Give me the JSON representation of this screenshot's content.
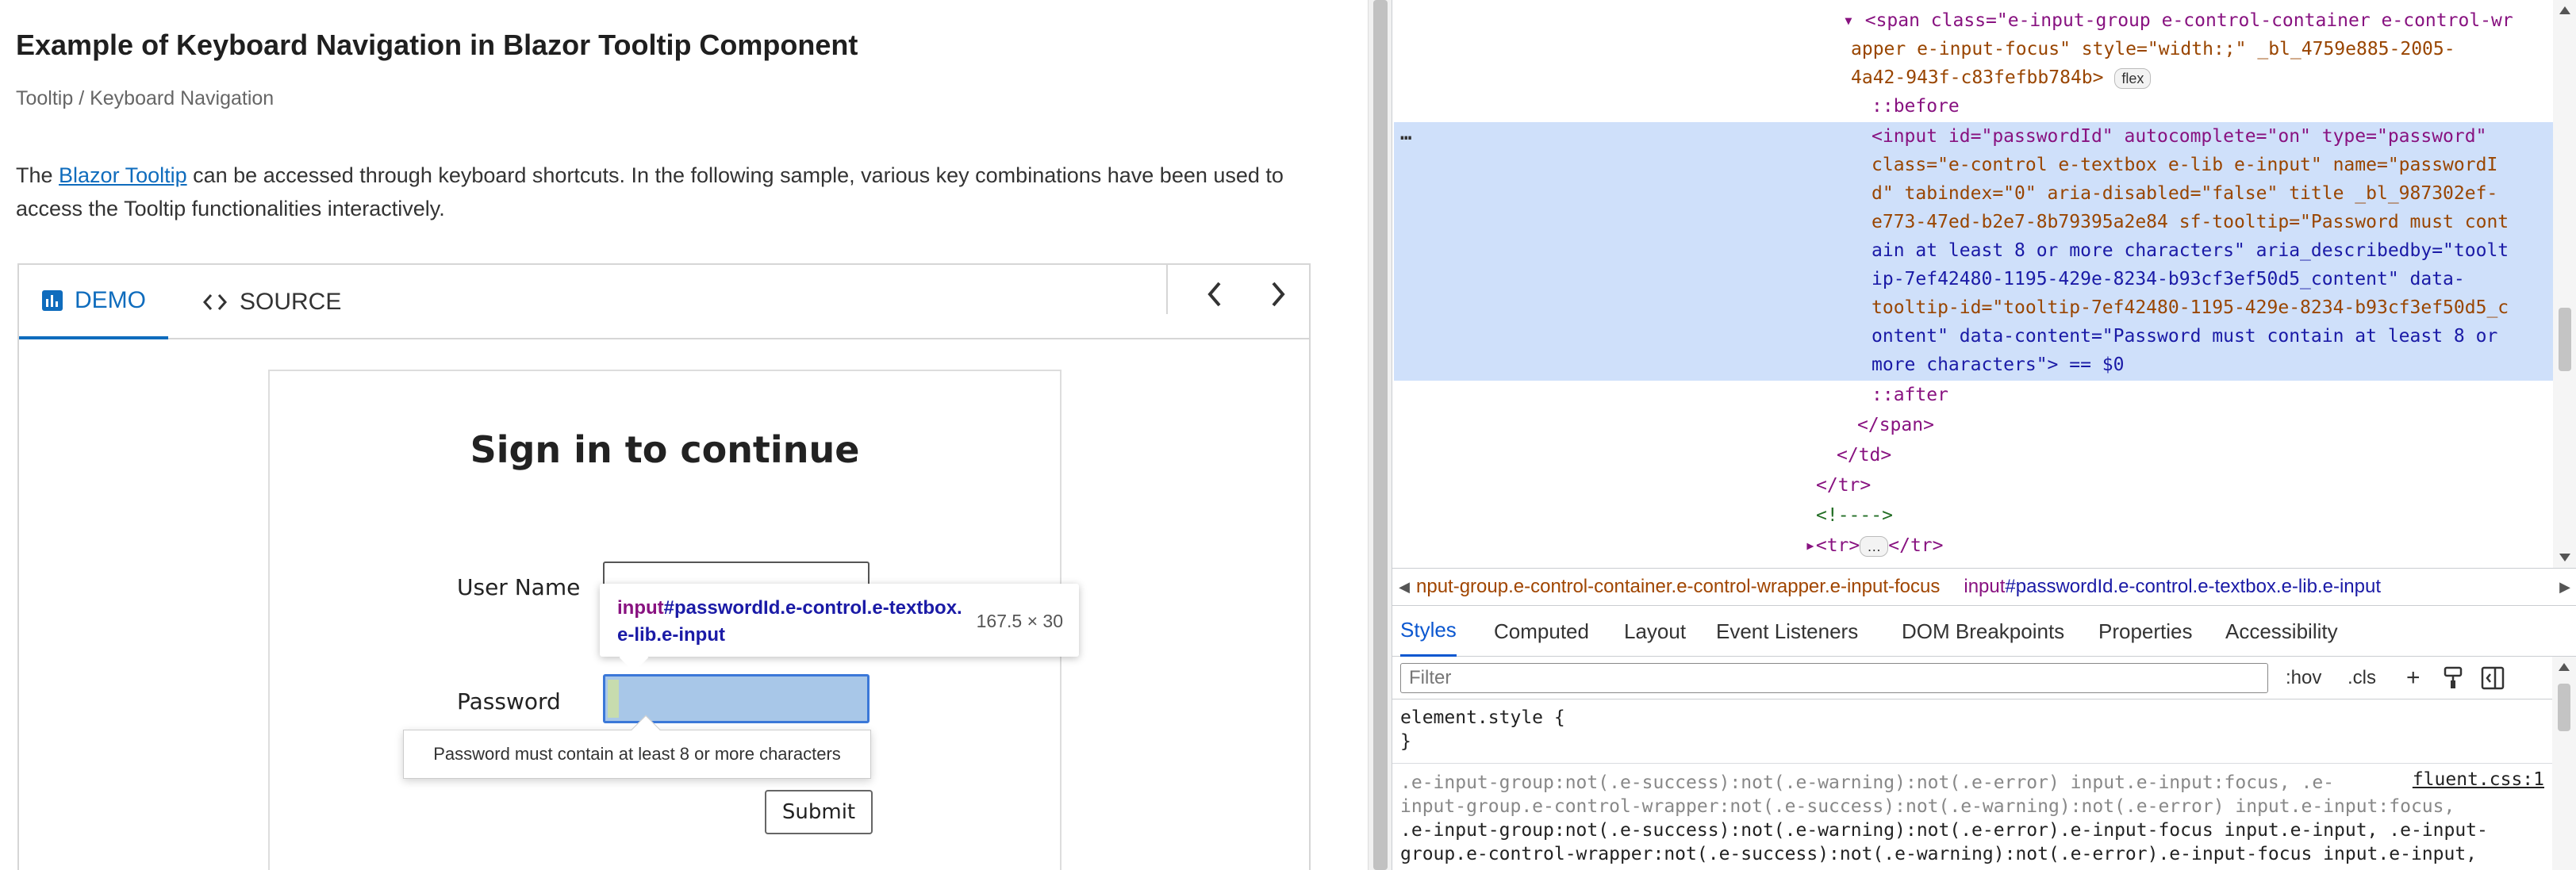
{
  "page": {
    "title": "Example of Keyboard Navigation in Blazor Tooltip Component",
    "breadcrumb": "Tooltip / Keyboard Navigation",
    "desc_before": "The ",
    "desc_link": "Blazor Tooltip",
    "desc_after": " can be accessed through keyboard shortcuts. In the following sample, various key combinations have been used to access the Tooltip functionalities interactively."
  },
  "demo": {
    "tabs": {
      "demo": "DEMO",
      "source": "SOURCE"
    },
    "icons": {
      "demo": "chart-icon",
      "source": "code-icon",
      "prev": "chevron-left-icon",
      "next": "chevron-right-icon"
    },
    "form": {
      "heading": "Sign in to continue",
      "username_label": "User Name",
      "password_label": "Password",
      "submit": "Submit"
    },
    "tooltip_text": "Password must contain at least 8 or more characters"
  },
  "inspect_tip": {
    "tag": "input",
    "selector": "#passwordId.e-control.e-textbox.e-lib.e-input",
    "size": "167.5 × 30"
  },
  "devtools": {
    "dom_lines": {
      "l1": "<span class=\"e-input-group e-control-container e-control-wr",
      "l2": "apper e-input-focus\" style=\"width:;\" _bl_4759e885-2005-",
      "l3": "4a42-943f-c83fefbb784b>",
      "l3_badge": "flex",
      "l4": "::before",
      "l5": "<input id=\"passwordId\" autocomplete=\"on\" type=\"password\"",
      "l6": "class=\"e-control e-textbox e-lib e-input\" name=\"passwordI",
      "l7": "d\" tabindex=\"0\" aria-disabled=\"false\" title _bl_987302ef-",
      "l8": "e773-47ed-b2e7-8b79395a2e84 sf-tooltip=\"Password must cont",
      "l9": "ain at least 8 or more characters\" aria_describedby=\"toolt",
      "l10": "ip-7ef42480-1195-429e-8234-b93cf3ef50d5_content\" data-",
      "l11": "tooltip-id=\"tooltip-7ef42480-1195-429e-8234-b93cf3ef50d5_c",
      "l12": "ontent\" data-content=\"Password must contain at least 8 or",
      "l13": "more characters\"> == $0",
      "l14": "::after",
      "l15": "</span>",
      "l16": "</td>",
      "l17": "</tr>",
      "l18": "<!---->",
      "l19": "<tr>",
      "l19_badge": "…",
      "l19_end": "</tr>",
      "ellipsis": "…"
    },
    "breadcrumbs": {
      "c1": "nput-group.e-control-container.e-control-wrapper.e-input-focus",
      "c2_tag": "input",
      "c2_rest": "#passwordId.e-control.e-textbox.e-lib.e-input"
    },
    "tabs": [
      "Styles",
      "Computed",
      "Layout",
      "Event Listeners",
      "DOM Breakpoints",
      "Properties",
      "Accessibility"
    ],
    "filter": {
      "placeholder": "Filter",
      "hov": ":hov",
      "cls": ".cls",
      "add": "+"
    },
    "styles": {
      "element_style": "element.style {",
      "close": "}",
      "r1": ".e-input-group:not(.e-success):not(.e-warning):not(.e-error) input.e-input:focus, .e-",
      "r2": "input-group.e-control-wrapper:not(.e-success):not(.e-warning):not(.e-error) input.e-input:focus,",
      "r3": ".e-input-group:not(.e-success):not(.e-warning):not(.e-error).e-input-focus input.e-input, .e-input-",
      "r4": "group.e-control-wrapper:not(.e-success):not(.e-warning):not(.e-error).e-input-focus input.e-input,",
      "source": "fluent.css:1"
    }
  }
}
